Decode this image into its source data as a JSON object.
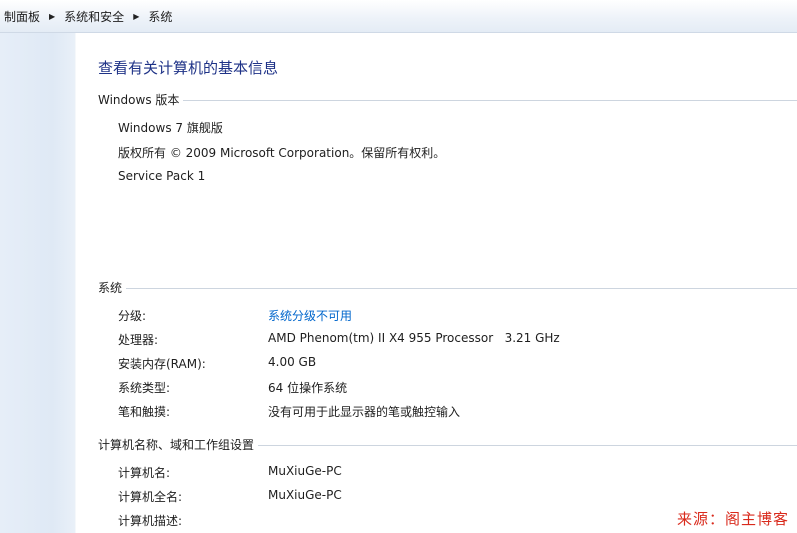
{
  "breadcrumb": {
    "items": [
      "制面板",
      "系统和安全",
      "系统"
    ]
  },
  "main": {
    "title": "查看有关计算机的基本信息",
    "windows_edition": {
      "heading": "Windows 版本",
      "edition": "Windows 7 旗舰版",
      "copyright": "版权所有 © 2009 Microsoft Corporation。保留所有权利。",
      "service_pack": "Service Pack 1"
    },
    "system": {
      "heading": "系统",
      "rows": [
        {
          "label": "分级:",
          "value": "系统分级不可用"
        },
        {
          "label": "处理器:",
          "value": "AMD Phenom(tm) II X4 955 Processor   3.21 GHz"
        },
        {
          "label": "安装内存(RAM):",
          "value": "4.00 GB"
        },
        {
          "label": "系统类型:",
          "value": "64 位操作系统"
        },
        {
          "label": "笔和触摸:",
          "value": "没有可用于此显示器的笔或触控输入"
        }
      ]
    },
    "computer": {
      "heading": "计算机名称、域和工作组设置",
      "rows": [
        {
          "label": "计算机名:",
          "value": "MuXiuGe-PC"
        },
        {
          "label": "计算机全名:",
          "value": "MuXiuGe-PC"
        },
        {
          "label": "计算机描述:",
          "value": ""
        }
      ]
    }
  },
  "watermark": "来源：阁主博客",
  "colors": {
    "title": "#1e3287",
    "link": "#0066cc",
    "watermark": "#d92a1c",
    "left_pane": "#dfe9f5"
  },
  "icons": {
    "breadcrumb_separator": "chevron-right-icon"
  }
}
